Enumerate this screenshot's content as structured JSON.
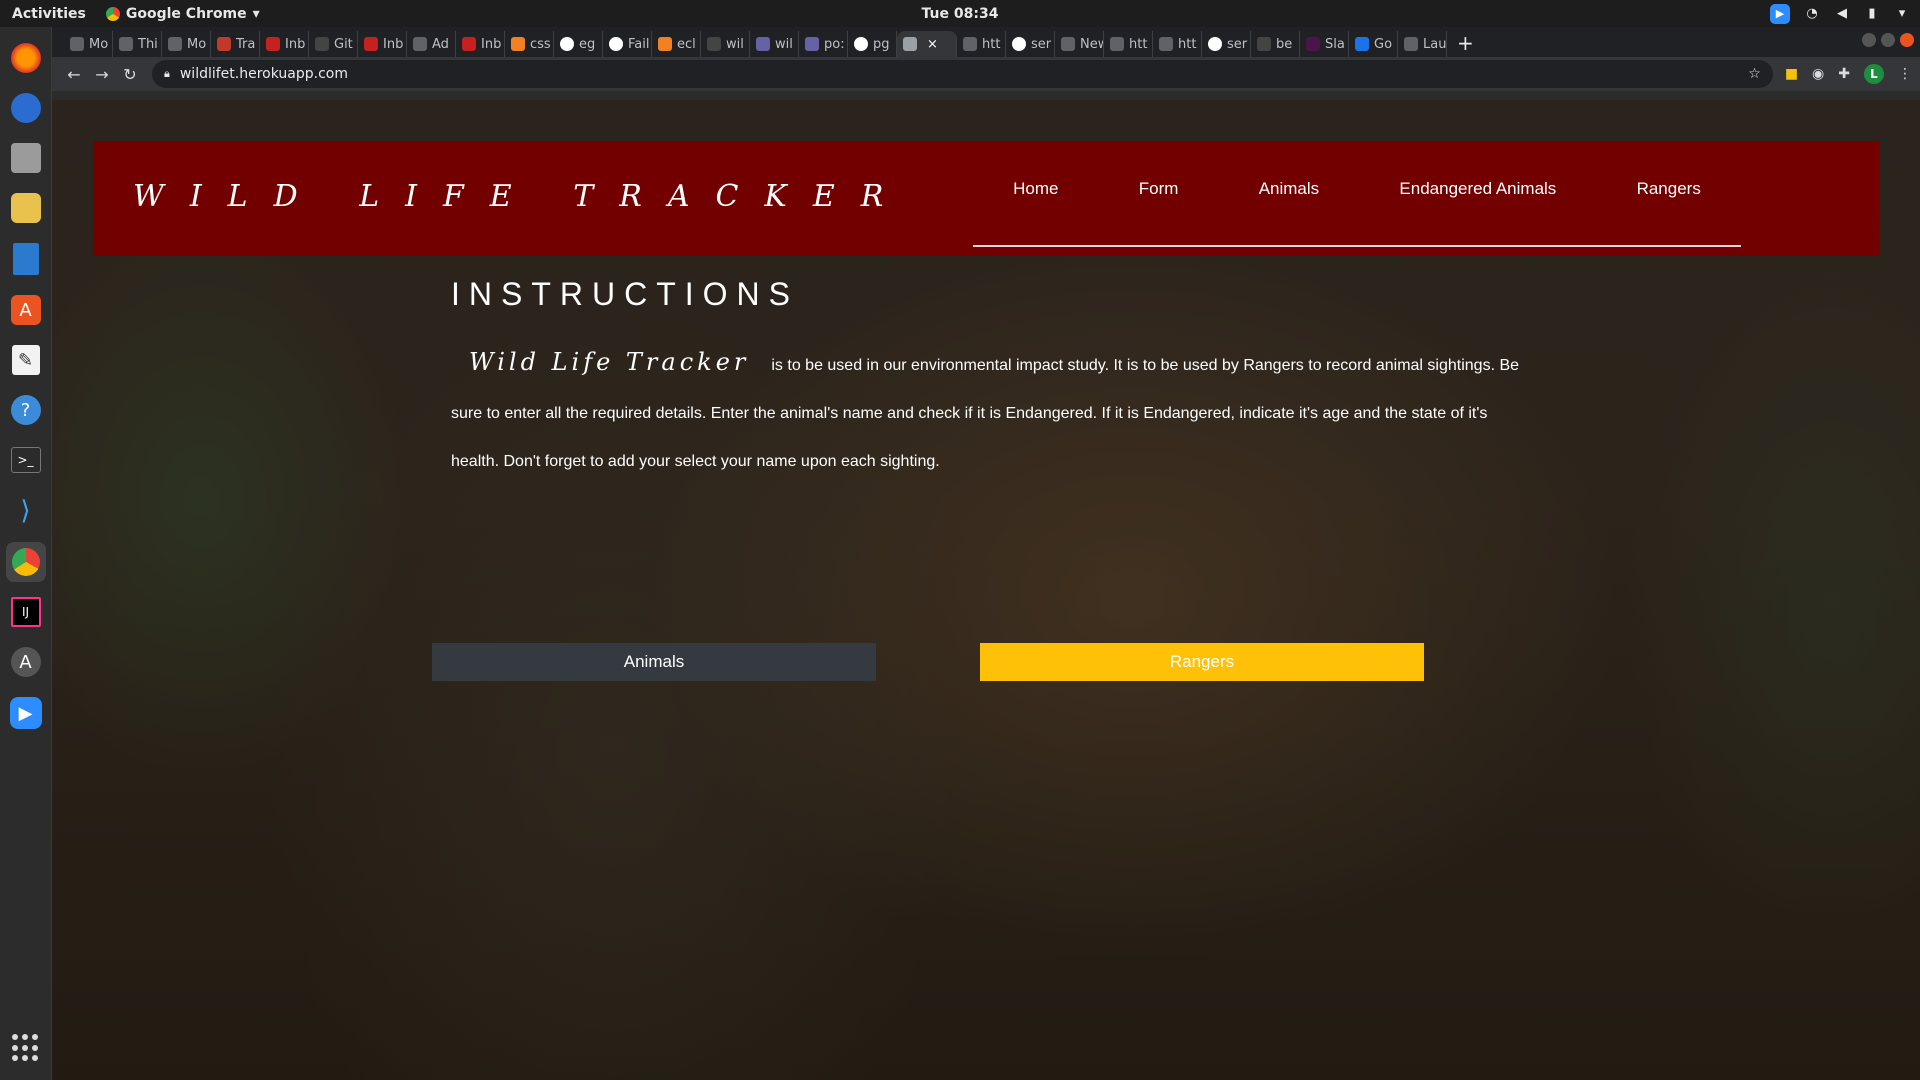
{
  "system": {
    "activities": "Activities",
    "app_name": "Google Chrome",
    "clock": "Tue 08:34"
  },
  "browser": {
    "tabs": [
      {
        "label": "Mo",
        "icon": "generic-tab-icon"
      },
      {
        "label": "Thi",
        "icon": "generic-tab-icon"
      },
      {
        "label": "Mo",
        "icon": "generic-tab-icon"
      },
      {
        "label": "Tra",
        "icon": "trello-icon"
      },
      {
        "label": "Inb",
        "icon": "gmail-icon"
      },
      {
        "label": "Git",
        "icon": "github-icon"
      },
      {
        "label": "Inb",
        "icon": "gmail-icon"
      },
      {
        "label": "Ad",
        "icon": "generic-tab-icon"
      },
      {
        "label": "Inb",
        "icon": "gmail-icon"
      },
      {
        "label": "css",
        "icon": "stackoverflow-icon"
      },
      {
        "label": "eg",
        "icon": "google-icon"
      },
      {
        "label": "Fail",
        "icon": "google-icon"
      },
      {
        "label": "ecl",
        "icon": "stackoverflow-icon"
      },
      {
        "label": "wil",
        "icon": "github-icon"
      },
      {
        "label": "wil",
        "icon": "heroku-icon"
      },
      {
        "label": "po:",
        "icon": "heroku-icon"
      },
      {
        "label": "pg",
        "icon": "google-icon"
      },
      {
        "label": "",
        "icon": "globe-icon",
        "active": true
      },
      {
        "label": "htt",
        "icon": "generic-tab-icon"
      },
      {
        "label": "ser",
        "icon": "google-icon"
      },
      {
        "label": "New T",
        "icon": "generic-tab-icon"
      },
      {
        "label": "htt",
        "icon": "generic-tab-icon"
      },
      {
        "label": "htt",
        "icon": "generic-tab-icon"
      },
      {
        "label": "ser",
        "icon": "google-icon"
      },
      {
        "label": "be",
        "icon": "github-icon"
      },
      {
        "label": "Sla",
        "icon": "slack-icon"
      },
      {
        "label": "Go",
        "icon": "calendar-icon"
      },
      {
        "label": "Lau",
        "icon": "generic-tab-icon"
      }
    ],
    "url": "wildlifet.herokuapp.com"
  },
  "site": {
    "brand": "WILD LIFE TRACKER",
    "nav": [
      "Home",
      "Form",
      "Animals",
      "Endangered Animals",
      "Rangers"
    ],
    "instructions_title": "INSTRUCTIONS",
    "inline_brand": "Wild Life Tracker",
    "instructions_text": "is to be used in our environmental impact study. It is to be used by Rangers to record animal sightings. Be sure to enter all the required details. Enter the animal's name and check if it is Endangered. If it is Endangered, indicate it's age and the state of it's health. Don't forget to add your select your name upon each sighting.",
    "buttons": {
      "animals": "Animals",
      "rangers": "Rangers"
    },
    "colors": {
      "header": "#720000",
      "animals_button": "#343a40",
      "rangers_button": "#ffc107"
    }
  }
}
